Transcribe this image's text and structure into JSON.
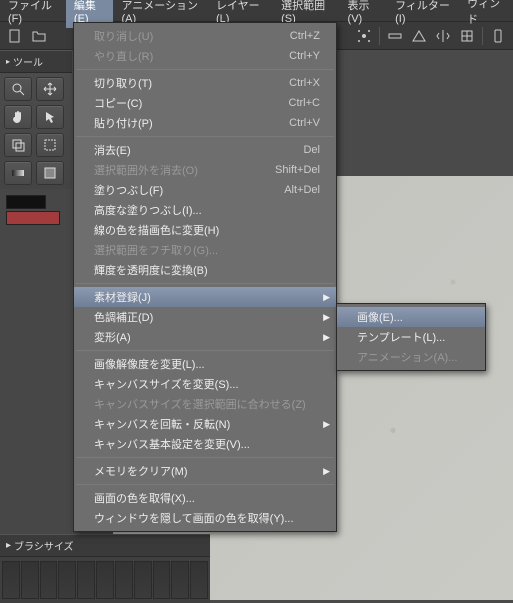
{
  "menubar": {
    "items": [
      {
        "label": "ファイル(F)"
      },
      {
        "label": "編集(E)"
      },
      {
        "label": "アニメーション(A)"
      },
      {
        "label": "レイヤー(L)"
      },
      {
        "label": "選択範囲(S)"
      },
      {
        "label": "表示(V)"
      },
      {
        "label": "フィルター(I)"
      },
      {
        "label": "ウィンド"
      }
    ],
    "active_index": 1
  },
  "sidebar": {
    "tool_title": "ツール",
    "brush_title": "ブラシサイズ"
  },
  "edit_menu": {
    "items": [
      {
        "label": "取り消し(U)",
        "shortcut": "Ctrl+Z",
        "disabled": true
      },
      {
        "label": "やり直し(R)",
        "shortcut": "Ctrl+Y",
        "disabled": true
      },
      {
        "sep": true
      },
      {
        "label": "切り取り(T)",
        "shortcut": "Ctrl+X"
      },
      {
        "label": "コピー(C)",
        "shortcut": "Ctrl+C"
      },
      {
        "label": "貼り付け(P)",
        "shortcut": "Ctrl+V"
      },
      {
        "sep": true
      },
      {
        "label": "消去(E)",
        "shortcut": "Del"
      },
      {
        "label": "選択範囲外を消去(O)",
        "shortcut": "Shift+Del",
        "disabled": true
      },
      {
        "label": "塗りつぶし(F)",
        "shortcut": "Alt+Del"
      },
      {
        "label": "高度な塗りつぶし(I)..."
      },
      {
        "label": "線の色を描画色に変更(H)"
      },
      {
        "label": "選択範囲をフチ取り(G)...",
        "disabled": true
      },
      {
        "label": "輝度を透明度に変換(B)"
      },
      {
        "sep": true
      },
      {
        "label": "素材登録(J)",
        "submenu": true,
        "hover": true
      },
      {
        "label": "色調補正(D)",
        "submenu": true
      },
      {
        "label": "変形(A)",
        "submenu": true
      },
      {
        "sep": true
      },
      {
        "label": "画像解像度を変更(L)..."
      },
      {
        "label": "キャンバスサイズを変更(S)..."
      },
      {
        "label": "キャンバスサイズを選択範囲に合わせる(Z)",
        "disabled": true
      },
      {
        "label": "キャンバスを回転・反転(N)",
        "submenu": true
      },
      {
        "label": "キャンバス基本設定を変更(V)..."
      },
      {
        "sep": true
      },
      {
        "label": "メモリをクリア(M)",
        "submenu": true
      },
      {
        "sep": true
      },
      {
        "label": "画面の色を取得(X)..."
      },
      {
        "label": "ウィンドウを隠して画面の色を取得(Y)..."
      }
    ]
  },
  "submenu": {
    "items": [
      {
        "label": "画像(E)...",
        "hover": true
      },
      {
        "label": "テンプレート(L)..."
      },
      {
        "label": "アニメーション(A)...",
        "disabled": true
      }
    ]
  }
}
